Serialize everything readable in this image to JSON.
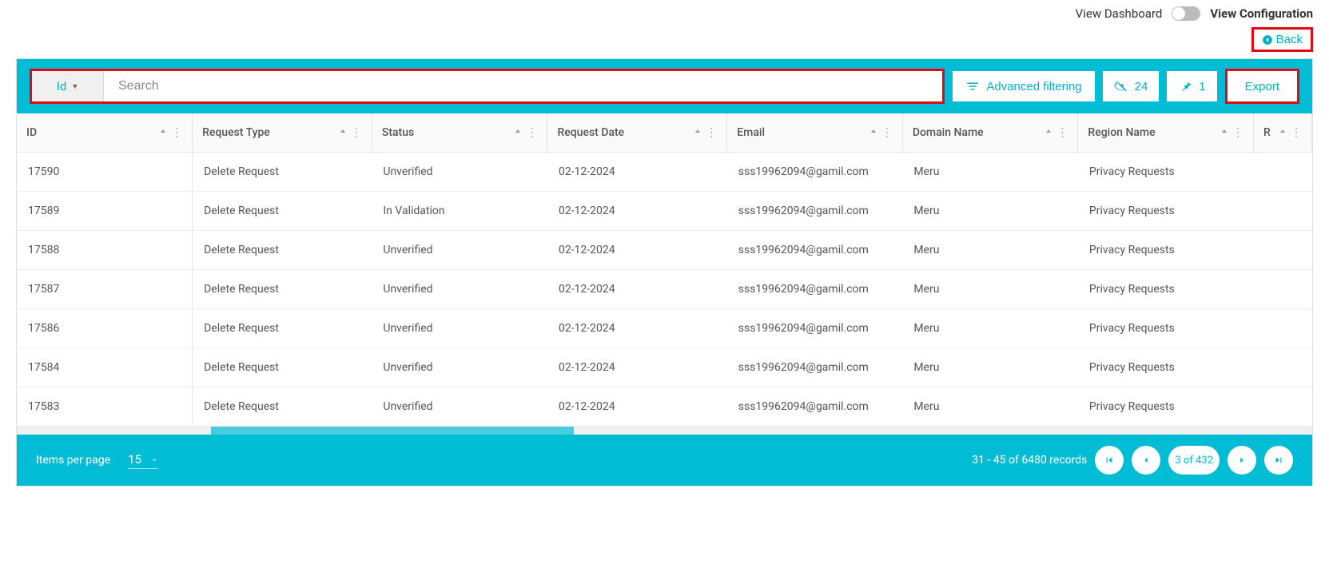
{
  "header": {
    "view_dashboard": "View Dashboard",
    "view_configuration": "View Configuration",
    "back": "Back"
  },
  "toolbar": {
    "id_dropdown": "Id",
    "search_placeholder": "Search",
    "advanced_filtering": "Advanced filtering",
    "hidden_count": "24",
    "pinned_count": "1",
    "export": "Export"
  },
  "columns": [
    {
      "label": "ID"
    },
    {
      "label": "Request Type"
    },
    {
      "label": "Status"
    },
    {
      "label": "Request Date"
    },
    {
      "label": "Email"
    },
    {
      "label": "Domain Name"
    },
    {
      "label": "Region Name"
    },
    {
      "label": "R"
    }
  ],
  "rows": [
    {
      "id": "17590",
      "type": "Delete Request",
      "status": "Unverified",
      "date": "02-12-2024",
      "email": "sss19962094@gamil.com",
      "domain": "Meru",
      "region": "Privacy Requests"
    },
    {
      "id": "17589",
      "type": "Delete Request",
      "status": "In Validation",
      "date": "02-12-2024",
      "email": "sss19962094@gamil.com",
      "domain": "Meru",
      "region": "Privacy Requests"
    },
    {
      "id": "17588",
      "type": "Delete Request",
      "status": "Unverified",
      "date": "02-12-2024",
      "email": "sss19962094@gamil.com",
      "domain": "Meru",
      "region": "Privacy Requests"
    },
    {
      "id": "17587",
      "type": "Delete Request",
      "status": "Unverified",
      "date": "02-12-2024",
      "email": "sss19962094@gamil.com",
      "domain": "Meru",
      "region": "Privacy Requests"
    },
    {
      "id": "17586",
      "type": "Delete Request",
      "status": "Unverified",
      "date": "02-12-2024",
      "email": "sss19962094@gamil.com",
      "domain": "Meru",
      "region": "Privacy Requests"
    },
    {
      "id": "17584",
      "type": "Delete Request",
      "status": "Unverified",
      "date": "02-12-2024",
      "email": "sss19962094@gamil.com",
      "domain": "Meru",
      "region": "Privacy Requests"
    },
    {
      "id": "17583",
      "type": "Delete Request",
      "status": "Unverified",
      "date": "02-12-2024",
      "email": "sss19962094@gamil.com",
      "domain": "Meru",
      "region": "Privacy Requests"
    }
  ],
  "pagination": {
    "items_per_page_label": "Items per page",
    "items_per_page_value": "15",
    "range_text": "31 - 45 of 6480 records",
    "page_text": "3 of 432"
  }
}
